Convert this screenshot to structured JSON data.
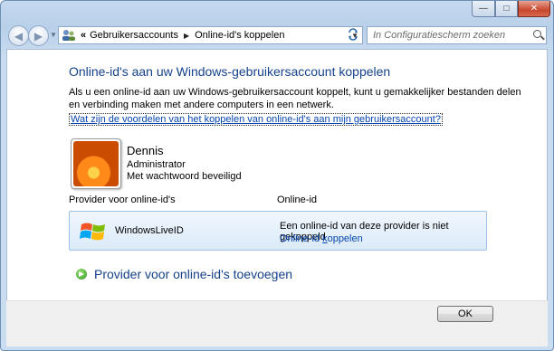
{
  "window": {
    "title_buttons": {
      "minimize": "—",
      "maximize": "□",
      "close": "✕"
    },
    "close_color": "#c7472d"
  },
  "address": {
    "chevron": "«",
    "segments": [
      "Gebruikersaccounts",
      "Online-id's koppelen"
    ],
    "refresh_icon": "refresh-icon"
  },
  "search": {
    "placeholder": "In Configuratiescherm zoeken"
  },
  "main": {
    "heading": "Online-id's aan uw Windows-gebruikersaccount koppelen",
    "description": "Als u een online-id aan uw Windows-gebruikersaccount koppelt, kunt u gemakkelijker bestanden delen en verbinding maken met andere computers in een netwerk.",
    "benefits_link": "Wat zijn de voordelen van het koppelen van online-id's aan mijn gebruikersaccount?",
    "user": {
      "name": "Dennis",
      "role": "Administrator",
      "password_status": "Met wachtwoord beveiligd"
    },
    "columns": {
      "provider": "Provider voor online-id's",
      "online_id": "Online-id"
    },
    "provider_row": {
      "name": "WindowsLiveID",
      "status": "Een online-id van deze provider is niet gekoppeld",
      "link_prefix": "Online-id ",
      "link_underlined": "k",
      "link_suffix": "oppelen"
    },
    "add_provider": "Provider voor online-id's toevoegen"
  },
  "footer": {
    "ok_label": "OK"
  },
  "colors": {
    "heading": "#15428b",
    "link": "#0645ad",
    "row_border": "#9fc3e7"
  }
}
